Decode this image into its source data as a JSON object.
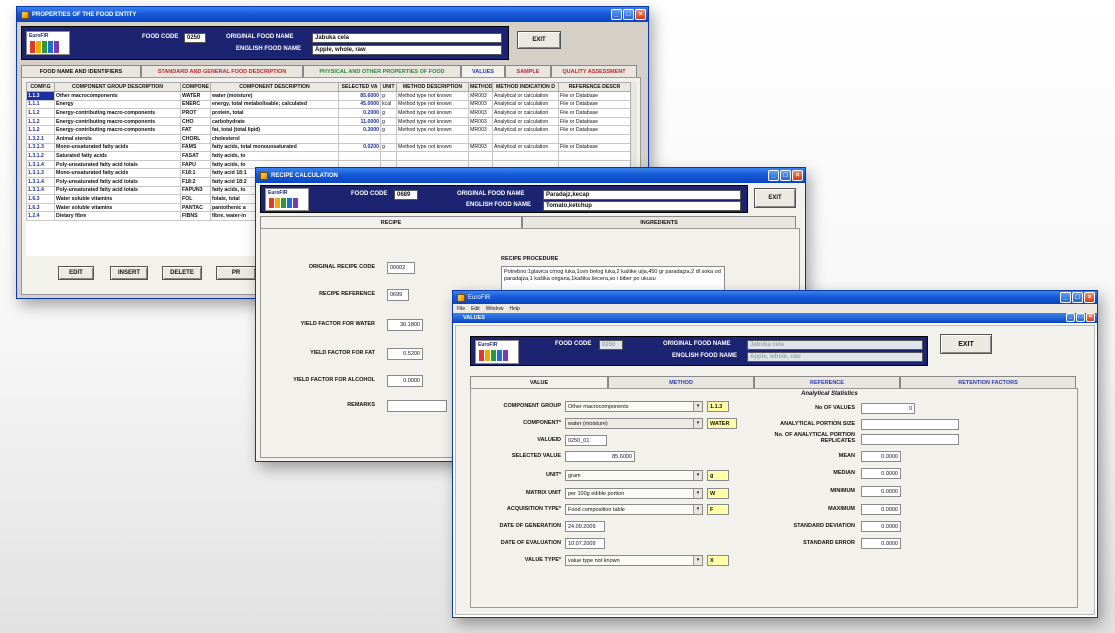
{
  "colors": {
    "title_blue": "#1659d8",
    "header_navy": "#1c2472",
    "code_blue": "#1c2fa0",
    "highlight_yellow": "#ffffa8"
  },
  "icons": [
    "app-icon",
    "minimize-icon",
    "maximize-icon",
    "close-icon",
    "dropdown-arrow-icon"
  ],
  "logo": {
    "text": "EuroFIR",
    "bar_colors": [
      "#e03a2a",
      "#f2a900",
      "#2a9a3a",
      "#1f6fd0",
      "#7b3ab3"
    ]
  },
  "win1": {
    "title": "PROPERTIES OF THE FOOD ENTITY",
    "food_code_label": "FOOD CODE",
    "food_code": "0250",
    "orig_name_label": "ORIGINAL FOOD NAME",
    "orig_name": "Jabuka cela",
    "eng_name_label": "ENGLISH FOOD NAME",
    "eng_name": "Apple, whole, raw",
    "exit": "EXIT",
    "tabs": [
      "FOOD NAME AND IDENTIFIERS",
      "STANDARD AND GENERAL FOOD DESCRIPTION",
      "PHYSICAL AND OTHER PROPERTIES OF FOOD",
      "VALUES",
      "SAMPLE",
      "QUALITY ASSESSMENT"
    ],
    "columns": [
      "COMP.G",
      "COMPONENT GROUP DESCRIPTION",
      "COMPONE",
      "COMPONENT DESCRIPTION",
      "SELECTED VA",
      "UNIT",
      "METHOD DESCRIPTION",
      "METHOD",
      "METHOD INDICATION D",
      "REFERENCE DESCR"
    ],
    "rows": [
      [
        "1.1.3",
        "Other macrocomponents",
        "WATER",
        "water (moisture)",
        "85.6000",
        "g",
        "Method type not known",
        "MR003",
        "Analytical or calculation",
        "File or Database"
      ],
      [
        "1.1.1",
        "Energy",
        "ENERC",
        "energy, total metabolisable; calculated",
        "45.0000",
        "kcal",
        "Method type not known",
        "MR003",
        "Analytical or calculation",
        "File or Database"
      ],
      [
        "1.1.2",
        "Energy-contributing macro-components",
        "PROT",
        "protein, total",
        "0.2000",
        "g",
        "Method type not known",
        "MR003",
        "Analytical or calculation",
        "File or Database"
      ],
      [
        "1.1.2",
        "Energy-contributing macro-components",
        "CHO",
        "carbohydrate",
        "11.0000",
        "g",
        "Method type not known",
        "MR003",
        "Analytical or calculation",
        "File or Database"
      ],
      [
        "1.1.2",
        "Energy-contributing macro-components",
        "FAT",
        "fat, total (total lipid)",
        "0.3000",
        "g",
        "Method type not known",
        "MR003",
        "Analytical or calculation",
        "File or Database"
      ],
      [
        "1.3.2.1",
        "Animal sterols",
        "CHORL",
        "cholesterol",
        "",
        "",
        "",
        "",
        "",
        ""
      ],
      [
        "1.3.1.3",
        "Mono-unsaturated fatty acids",
        "FAMS",
        "fatty acids, total monounsaturated",
        "0.0200",
        "g",
        "Method type not known",
        "MR003",
        "Analytical or calculation",
        "File or Database"
      ],
      [
        "1.3.1.2",
        "Saturated fatty acids",
        "FASAT",
        "fatty acids, to",
        "",
        "",
        "",
        "",
        "",
        ""
      ],
      [
        "1.3.1.4",
        "Poly-unsaturated fatty acid totals",
        "FAPU",
        "fatty acids, to",
        "",
        "",
        "",
        "",
        "",
        ""
      ],
      [
        "1.3.1.3",
        "Mono-unsaturated fatty acids",
        "F18:1",
        "fatty acid 18:1",
        "",
        "",
        "",
        "",
        "",
        ""
      ],
      [
        "1.3.1.4",
        "Poly-unsaturated fatty acid totals",
        "F18:2",
        "fatty acid 18:2",
        "",
        "",
        "",
        "",
        "",
        ""
      ],
      [
        "1.3.1.4",
        "Poly-unsaturated fatty acid totals",
        "FAPUN3",
        "fatty acids, to",
        "",
        "",
        "",
        "",
        "",
        ""
      ],
      [
        "1.6.3",
        "Water soluble vitamins",
        "FOL",
        "folate, total",
        "",
        "",
        "",
        "",
        "",
        ""
      ],
      [
        "1.6.3",
        "Water soluble vitamins",
        "PANTAC",
        "pantothenic a",
        "",
        "",
        "",
        "",
        "",
        ""
      ],
      [
        "1.2.4",
        "Dietary fibre",
        "FIBNS",
        "fibre, water-in",
        "",
        "",
        "",
        "",
        "",
        ""
      ]
    ],
    "buttons": [
      "EDIT",
      "INSERT",
      "DELETE",
      "PR"
    ]
  },
  "win2": {
    "title": "RECIPE CALCULATION",
    "food_code_label": "FOOD CODE",
    "food_code": "0689",
    "orig_name_label": "ORIGINAL FOOD NAME",
    "orig_name": "Paradajz,kecap",
    "eng_name_label": "ENGLISH FOOD NAME",
    "eng_name": "Tomato,ketchup",
    "exit": "EXIT",
    "tabs": [
      "RECIPE",
      "INGREDIENTS"
    ],
    "orig_recipe_code_label": "ORIGINAL RECIPE CODE",
    "orig_recipe_code": "00002",
    "recipe_ref_label": "RECIPE REFERENCE",
    "recipe_ref": "0699",
    "yield_water_label": "YIELD FACTOR FOR WATER",
    "yield_water": "30.1800",
    "yield_fat_label": "YIELD FACTOR FOR FAT",
    "yield_fat": "0.5200",
    "yield_alcohol_label": "YIELD FACTOR FOR ALCOHOL",
    "yield_alcohol": "0.0000",
    "remarks_label": "REMARKS",
    "procedure_label": "RECIPE PROCEDURE",
    "procedure": "Potrebno:1glavica crnog luka,1cen belog luka,2 kašike ulja,450 gr paradajza,2 dl soka od paradajza,1 kašika origana,1kašika šecera,so i biber po ukusu"
  },
  "win3": {
    "title": "EuroFIR",
    "menu": [
      "File",
      "Edit",
      "Window",
      "Help"
    ],
    "child_title": "VALUES",
    "food_code_label": "FOOD CODE",
    "food_code": "0250",
    "orig_name_label": "ORIGINAL FOOD NAME",
    "orig_name": "Jabuka cela",
    "eng_name_label": "ENGLISH FOOD NAME",
    "eng_name": "Apple, whole, raw",
    "exit": "EXIT",
    "tabs": [
      "VALUE",
      "METHOD",
      "REFERENCE",
      "RETENTION FACTORS"
    ],
    "component_group_label": "COMPONENT GROUP",
    "component_group": "Other macrocomponents",
    "component_group_code": "1.1.3",
    "component_label": "COMPONENT*",
    "component": "water (moisture)",
    "component_code": "WATER",
    "valueid_label": "VALUEID",
    "valueid": "0250_01",
    "selected_value_label": "SELECTED VALUE",
    "selected_value": "85.6000",
    "unit_label": "UNIT*",
    "unit": "gram",
    "unit_code": "g",
    "matrix_unit_label": "MATRIX UNIT",
    "matrix_unit": "per 100g edible portion",
    "matrix_unit_code": "W",
    "acquisition_label": "ACQUISITION TYPE*",
    "acquisition": "Food composition table",
    "acquisition_code": "F",
    "gen_date_label": "DATE OF GENERATION",
    "gen_date": "24.09.2009",
    "eval_date_label": "DATE OF EVALUATION",
    "eval_date": "10.07.2009",
    "value_type_label": "VALUE TYPE*",
    "value_type": "value type not known",
    "value_type_code": "X",
    "stats_title": "Analytical Statistics",
    "no_values_label": "No OF VALUES",
    "no_values": "0",
    "portion_size_label": "ANALYTICAL PORTION SIZE",
    "portion_reps_label": "No. OF ANALYTICAL PORTION REPLICATES",
    "mean_label": "MEAN",
    "mean": "0.0000",
    "median_label": "MEDIAN",
    "median": "0.0000",
    "minimum_label": "MINIMUM",
    "minimum": "0.0000",
    "maximum_label": "MAXIMUM",
    "maximum": "0.0000",
    "std_dev_label": "STANDARD DEVIATION",
    "std_dev": "0.0000",
    "std_err_label": "STANDARD ERROR",
    "std_err": "0.0000"
  }
}
